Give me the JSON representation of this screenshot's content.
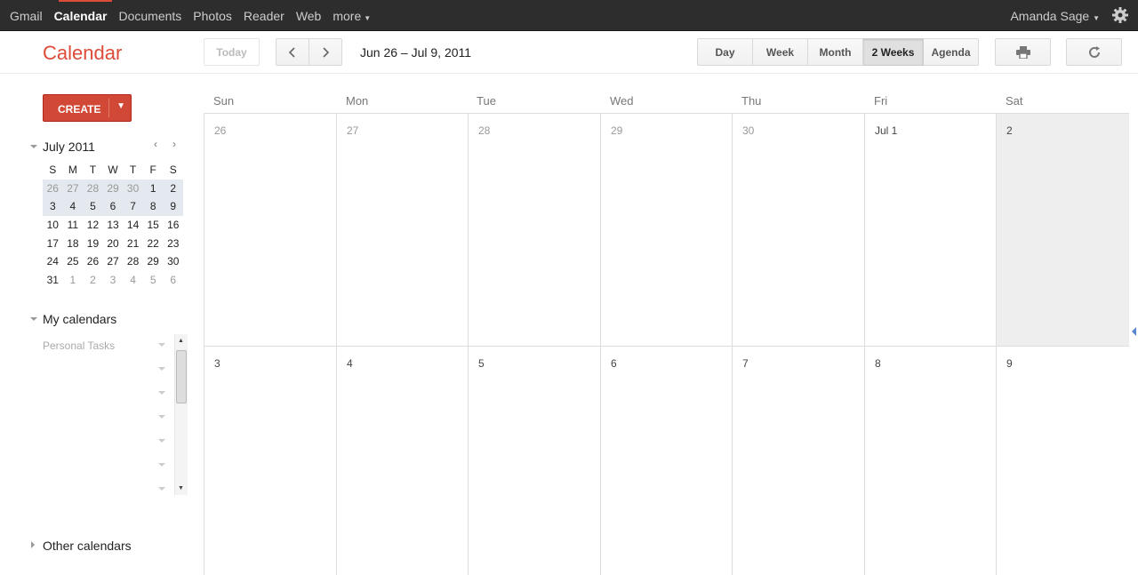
{
  "topbar": {
    "nav": [
      "Gmail",
      "Calendar",
      "Documents",
      "Photos",
      "Reader",
      "Web",
      "more"
    ],
    "user_name": "Amanda Sage"
  },
  "header": {
    "app_title": "Calendar",
    "today_label": "Today",
    "date_range": "Jun 26 – Jul 9, 2011",
    "views": [
      "Day",
      "Week",
      "Month",
      "2 Weeks",
      "Agenda"
    ],
    "selected_view": "2 Weeks"
  },
  "sidebar": {
    "create_label": "CREATE",
    "mini_cal": {
      "title": "July 2011",
      "weekdays": [
        "S",
        "M",
        "T",
        "W",
        "T",
        "F",
        "S"
      ],
      "weeks": [
        [
          "26",
          "27",
          "28",
          "29",
          "30",
          "1",
          "2"
        ],
        [
          "3",
          "4",
          "5",
          "6",
          "7",
          "8",
          "9"
        ],
        [
          "10",
          "11",
          "12",
          "13",
          "14",
          "15",
          "16"
        ],
        [
          "17",
          "18",
          "19",
          "20",
          "21",
          "22",
          "23"
        ],
        [
          "24",
          "25",
          "26",
          "27",
          "28",
          "29",
          "30"
        ],
        [
          "31",
          "1",
          "2",
          "3",
          "4",
          "5",
          "6"
        ]
      ]
    },
    "my_calendars_title": "My calendars",
    "my_calendars": [
      "Personal Tasks"
    ],
    "other_calendars_title": "Other calendars"
  },
  "grid": {
    "weekdays": [
      "Sun",
      "Mon",
      "Tue",
      "Wed",
      "Thu",
      "Fri",
      "Sat"
    ],
    "week1": [
      "26",
      "27",
      "28",
      "29",
      "30",
      "Jul 1",
      "2"
    ],
    "week2": [
      "3",
      "4",
      "5",
      "6",
      "7",
      "8",
      "9"
    ]
  },
  "colors": {
    "accent": "#dd4b39",
    "create_button": "#d14836",
    "topbar": "#2d2d2d",
    "today_highlight": "#eeeeee"
  }
}
